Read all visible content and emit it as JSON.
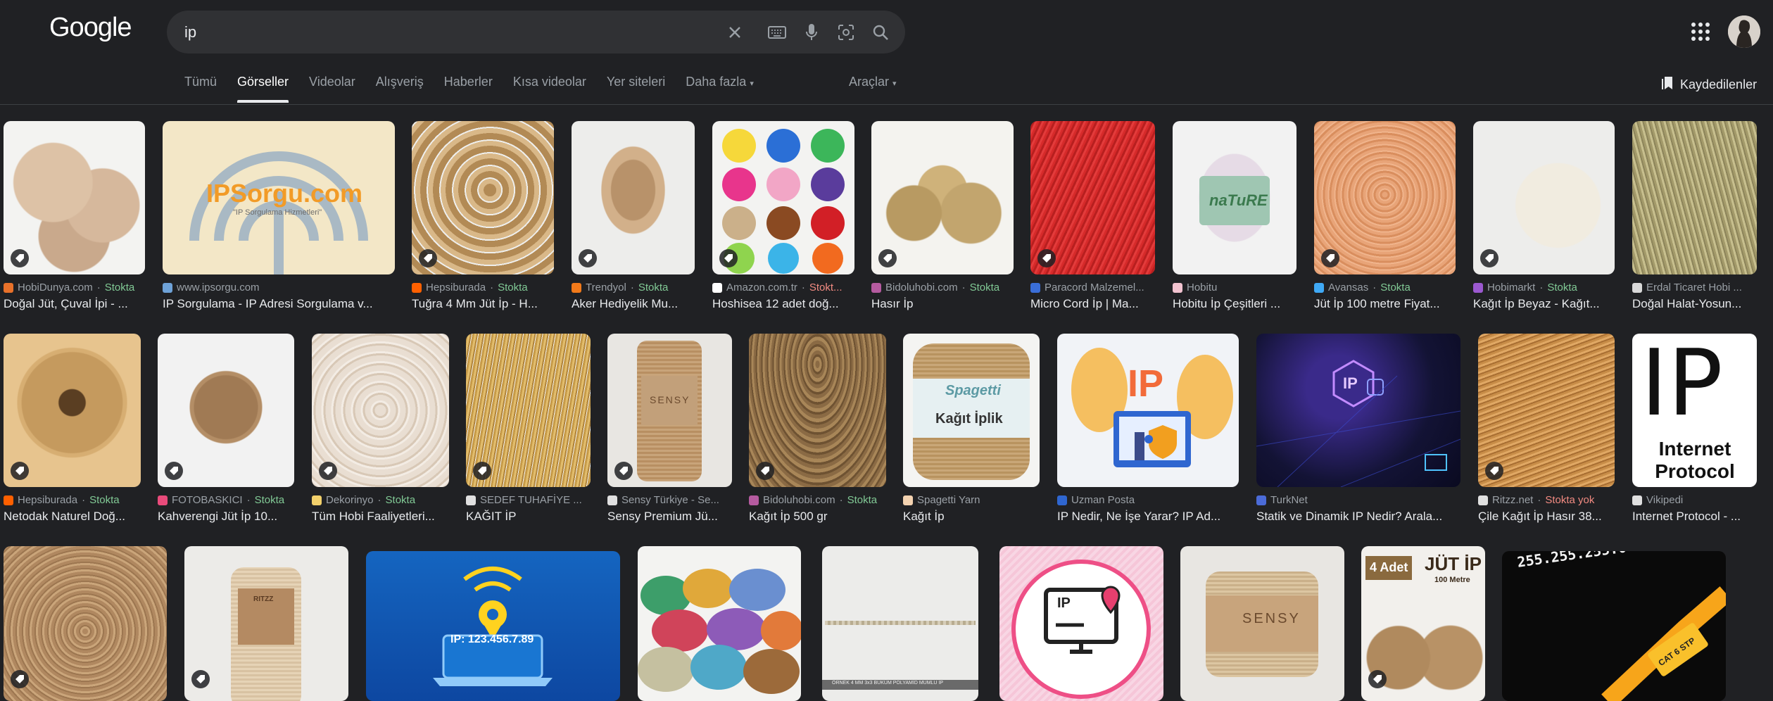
{
  "header": {
    "logo": "Google",
    "query": "ip",
    "icons": [
      "close-icon",
      "keyboard-icon",
      "mic-icon",
      "lens-icon",
      "search-icon",
      "apps-icon"
    ]
  },
  "tabs": [
    {
      "label": "Tümü"
    },
    {
      "label": "Görseller"
    },
    {
      "label": "Videolar"
    },
    {
      "label": "Alışveriş"
    },
    {
      "label": "Haberler"
    },
    {
      "label": "Kısa videolar"
    },
    {
      "label": "Yer siteleri"
    },
    {
      "label": "Daha fazla"
    }
  ],
  "tools_label": "Araçlar",
  "saved_label": "Kaydedilenler",
  "colors": {
    "background": "#202124",
    "stock": "#81c995",
    "out_of_stock": "#f28b82"
  },
  "results": {
    "row1": [
      {
        "source": "HobiDunya.com",
        "stock": "Stokta",
        "title": "Doğal Jüt, Çuval İpi - ..."
      },
      {
        "source": "www.ipsorgu.com",
        "stock": "",
        "title": "IP Sorgulama - IP Adresi Sorgulama v...",
        "overlay": "IPSorgu.com",
        "overlay_sub": "\"IP Sorgulama Hizmetleri\""
      },
      {
        "source": "Hepsiburada",
        "stock": "Stokta",
        "title": "Tuğra 4 Mm Jüt İp - H..."
      },
      {
        "source": "Trendyol",
        "stock": "Stokta",
        "title": "Aker Hediyelik Mu..."
      },
      {
        "source": "Amazon.com.tr",
        "stock": "Stokt...",
        "stock_red": true,
        "title": "Hoshisea 12 adet doğ..."
      },
      {
        "source": "Bidoluhobi.com",
        "stock": "Stokta",
        "title": "Hasır İp"
      },
      {
        "source": "Paracord Malzemel...",
        "stock": "",
        "title": "Micro Cord İp | Ma..."
      },
      {
        "source": "Hobitu",
        "stock": "",
        "title": "Hobitu İp Çeşitleri ...",
        "overlay": "naTuRE"
      },
      {
        "source": "Avansas",
        "stock": "Stokta",
        "title": "Jüt İp 100 metre Fiyat..."
      },
      {
        "source": "Hobimarkt",
        "stock": "Stokta",
        "title": "Kağıt İp Beyaz - Kağıt..."
      },
      {
        "source": "Erdal Ticaret Hobi ...",
        "stock": "",
        "title": "Doğal Halat-Yosun..."
      }
    ],
    "row2": [
      {
        "source": "Hepsiburada",
        "stock": "Stokta",
        "title": "Netodak Naturel Doğ..."
      },
      {
        "source": "FOTOBASKICI",
        "stock": "Stokta",
        "title": "Kahverengi Jüt İp 10..."
      },
      {
        "source": "Dekorinyo",
        "stock": "Stokta",
        "title": "Tüm Hobi Faaliyetleri..."
      },
      {
        "source": "SEDEF TUHAFİYE ...",
        "stock": "",
        "title": "KAĞIT İP"
      },
      {
        "source": "Sensy Türkiye - Se...",
        "stock": "",
        "title": "Sensy Premium Jü...",
        "overlay": "SENSY"
      },
      {
        "source": "Bidoluhobi.com",
        "stock": "Stokta",
        "title": "Kağıt İp 500 gr"
      },
      {
        "source": "Spagetti Yarn",
        "stock": "",
        "title": "Kağıt İp",
        "overlay": "Spagetti",
        "overlay_sub": "Kağıt İplik"
      },
      {
        "source": "Uzman Posta",
        "stock": "",
        "title": "IP Nedir, Ne İşe Yarar? IP Ad...",
        "overlay": "IP"
      },
      {
        "source": "TurkNet",
        "stock": "",
        "title": "Statik ve Dinamik IP Nedir? Arala...",
        "overlay": "IP"
      },
      {
        "source": "Ritzz.net",
        "stock": "Stokta yok",
        "stock_red": true,
        "title": "Çile Kağıt İp Hasır 38..."
      },
      {
        "source": "Vikipedi",
        "stock": "",
        "title": "Internet Protocol - ...",
        "overlay": "IP",
        "overlay_sub": "Internet Protocol"
      }
    ],
    "row3": [
      {
        "title": ""
      },
      {
        "title": "",
        "overlay": "RITZZ"
      },
      {
        "title": "",
        "overlay": "IP: 123.456.7.89"
      },
      {
        "title": ""
      },
      {
        "title": "",
        "overlay": "ÖRNEK 4 MM 3x3 BÜKÜM POLYAMİD MUMLU İP"
      },
      {
        "title": "",
        "overlay": "IP"
      },
      {
        "title": "",
        "overlay": "SENSY"
      },
      {
        "title": "",
        "overlay": "4 Adet",
        "overlay_sub": "JÜT İP",
        "overlay_sub2": "100 Metre"
      },
      {
        "title": "",
        "overlay": "255.255.255.0",
        "overlay_sub": "CAT 6 STP"
      }
    ]
  }
}
